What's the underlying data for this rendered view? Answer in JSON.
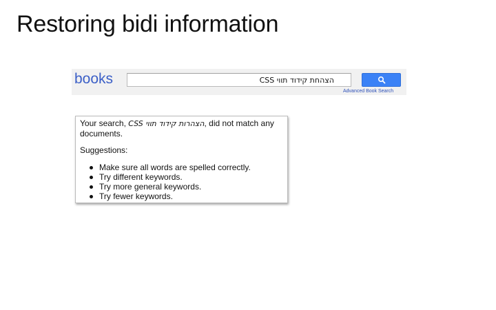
{
  "slide": {
    "title": "Restoring bidi information"
  },
  "search": {
    "logo": "books",
    "query": "הצהחת קידוד תווי CSS",
    "button_icon": "search-icon",
    "advanced_link": "Advanced Book Search"
  },
  "results": {
    "prefix": "Your search, ",
    "query": "הצהרות קידוד תווי CSS",
    "suffix": ", did not match any documents.",
    "suggestions_heading": "Suggestions:",
    "suggestions": [
      "Make sure all words are spelled correctly.",
      "Try different keywords.",
      "Try more general keywords.",
      "Try fewer keywords."
    ]
  },
  "colors": {
    "logo": "#3b5fc7",
    "button": "#3b82f6",
    "link": "#2c4fb8"
  }
}
